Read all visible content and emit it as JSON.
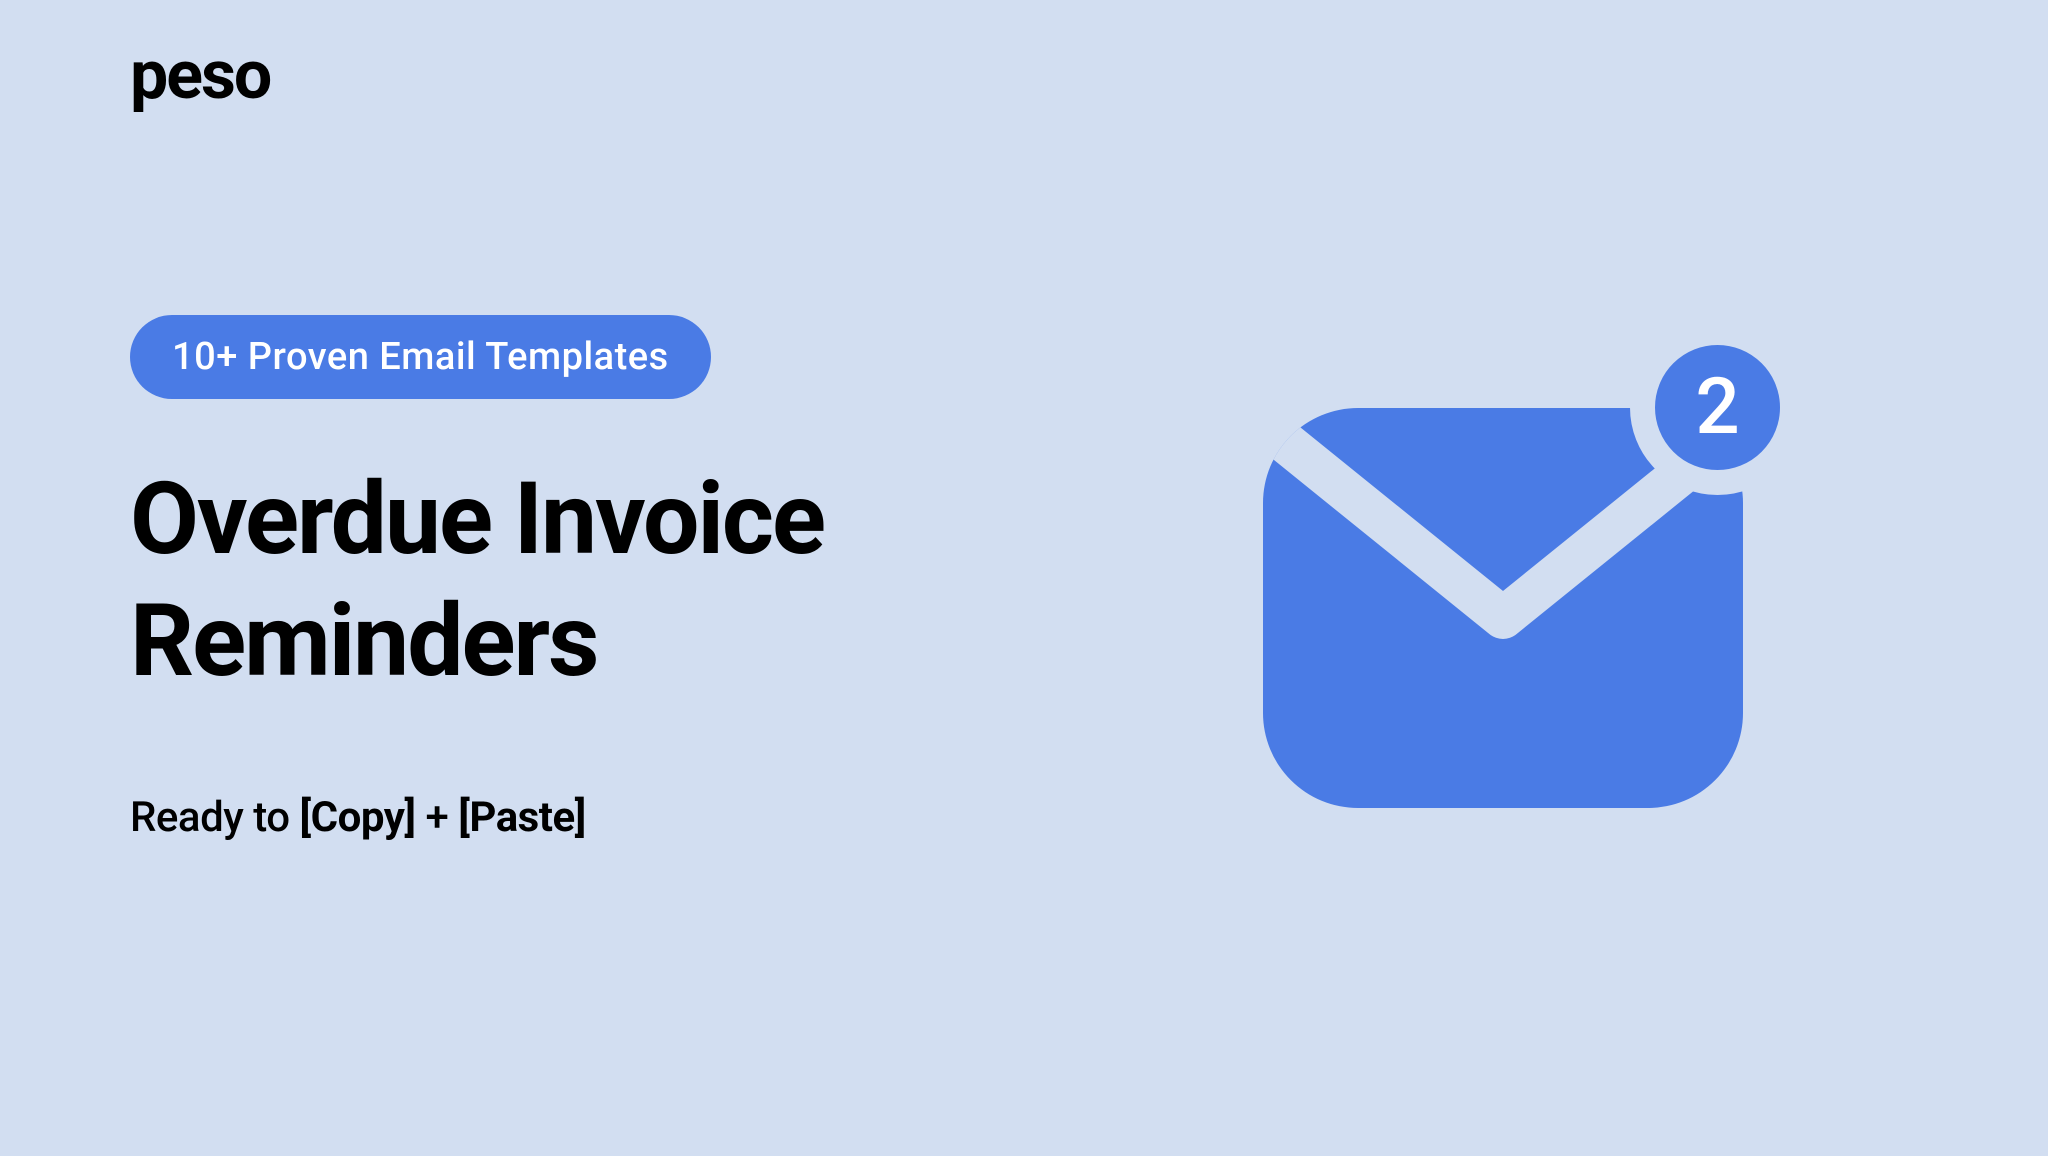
{
  "brand": "peso",
  "pill": "10+ Proven Email Templates",
  "title_line1": "Overdue Invoice",
  "title_line2": "Reminders",
  "subtitle": {
    "prefix": "Ready to ",
    "keyword1": "[Copy]",
    "plus": " + ",
    "keyword2": "[Paste]"
  },
  "badge_count": "2",
  "colors": {
    "background": "#D2DEF1",
    "accent": "#4A7BE5",
    "text_primary": "#000000",
    "text_on_accent": "#FFFFFF"
  }
}
